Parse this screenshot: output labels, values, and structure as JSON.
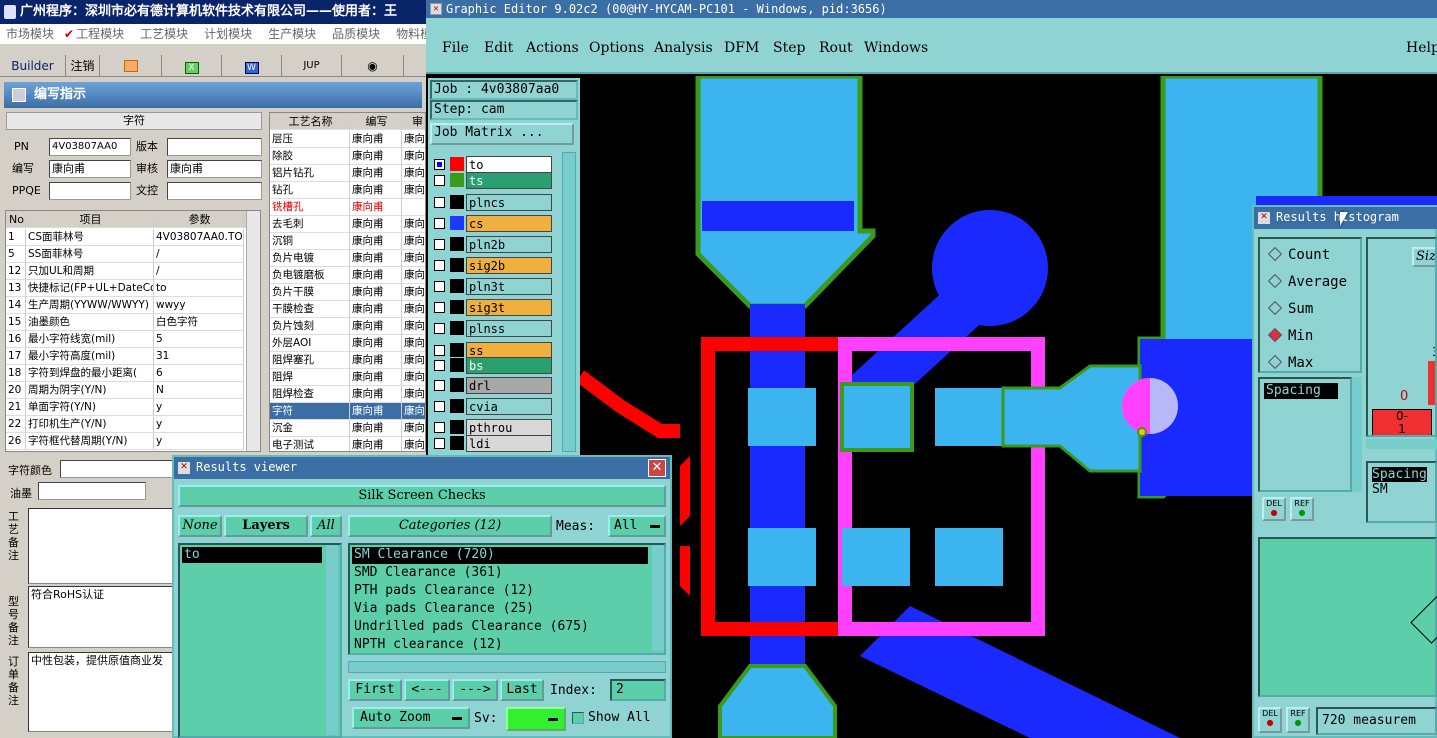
{
  "left_app": {
    "title": "广州程序：深圳市必有德计算机软件技术有限公司——使用者：王",
    "menu": [
      "市场模块",
      "工程模块",
      "工艺模块",
      "计划模块",
      "生产模块",
      "品质模块",
      "物料模"
    ],
    "toolbar": [
      "Builder",
      "注销",
      "JUP"
    ],
    "subtitle": "编写指示",
    "form_header": "字符",
    "pn_label": "PN",
    "pn_value": "4V03807AA0",
    "version_label": "版本",
    "version_value": "",
    "author_label": "编写",
    "author_value": "康向甫",
    "review_label": "审核",
    "review_value": "康向甫",
    "ppqe_label": "PPQE",
    "ppqe_value": "",
    "doc_label": "文控",
    "doc_value": "",
    "param_headers": [
      "No",
      "项目",
      "参数"
    ],
    "params": [
      [
        "1",
        "CS面菲林号",
        "4V03807AA0.TO"
      ],
      [
        "5",
        "SS面菲林号",
        "/"
      ],
      [
        "12",
        "只加UL和周期",
        "/"
      ],
      [
        "13",
        "快捷标记(FP+UL+DateCo",
        "to"
      ],
      [
        "14",
        "生产周期(YYWW/WWYY)",
        "wwyy"
      ],
      [
        "15",
        "油墨颜色",
        "白色字符"
      ],
      [
        "16",
        "最小字符线宽(mil)",
        "5"
      ],
      [
        "17",
        "最小字符高度(mil)",
        "31"
      ],
      [
        "18",
        "字符到焊盘的最小距离(",
        "6"
      ],
      [
        "20",
        "周期为阴字(Y/N)",
        "N"
      ],
      [
        "21",
        "单面字符(Y/N)",
        "y"
      ],
      [
        "22",
        "打印机生产(Y/N)",
        "y"
      ],
      [
        "26",
        "字符框代替周期(Y/N)",
        "y"
      ]
    ],
    "proc_headers": [
      "工艺名称",
      "编写",
      "审"
    ],
    "procs": [
      [
        "层压",
        "康向甫",
        "康向"
      ],
      [
        "除胶",
        "康向甫",
        "康向"
      ],
      [
        "铝片钻孔",
        "康向甫",
        "康向"
      ],
      [
        "钻孔",
        "康向甫",
        "康向"
      ],
      [
        "铣槽孔",
        "康向甫",
        ""
      ],
      [
        "去毛刺",
        "康向甫",
        "康向"
      ],
      [
        "沉铜",
        "康向甫",
        "康向"
      ],
      [
        "负片电镀",
        "康向甫",
        "康向"
      ],
      [
        "负电镀磨板",
        "康向甫",
        "康向"
      ],
      [
        "负片干膜",
        "康向甫",
        "康向"
      ],
      [
        "干膜检查",
        "康向甫",
        "康向"
      ],
      [
        "负片蚀刻",
        "康向甫",
        "康向"
      ],
      [
        "外层AOI",
        "康向甫",
        "康向"
      ],
      [
        "阻焊塞孔",
        "康向甫",
        "康向"
      ],
      [
        "阻焊",
        "康向甫",
        "康向"
      ],
      [
        "阻焊检查",
        "康向甫",
        "康向"
      ],
      [
        "字符",
        "康向甫",
        "康向"
      ],
      [
        "沉金",
        "康向甫",
        "康向"
      ],
      [
        "电子测试",
        "康向甫",
        "康向"
      ]
    ],
    "char_color_label": "字符颜色",
    "ink_label": "油墨",
    "craft_note_label": "工艺备注",
    "model_note_label": "型号备注",
    "model_note_value": "符合RoHS认证",
    "order_note_label": "订单备注",
    "order_note_value": "中性包装，提供原值商业发"
  },
  "editor": {
    "title": "Graphic Editor 9.02c2 (00@HY-HYCAM-PC101 - Windows, pid:3656)",
    "menu": [
      "File",
      "Edit",
      "Actions",
      "Options",
      "Analysis",
      "DFM",
      "Step",
      "Rout",
      "Windows"
    ],
    "help": "Help",
    "job": "Job : 4v03807aa0",
    "step": "Step: cam",
    "job_matrix": "Job Matrix ...",
    "layers": [
      {
        "name": "to",
        "color": "#ff0000",
        "bg": "#ffffff"
      },
      {
        "name": "ts",
        "color": "#3a9a1a",
        "bg": "#2aa070"
      },
      {
        "name": "plncs",
        "color": "#000000",
        "bg": "#8fd3d3"
      },
      {
        "name": "cs",
        "color": "#1a3aff",
        "bg": "#f0b040"
      },
      {
        "name": "pln2b",
        "color": "#000000",
        "bg": "#8fd3d3"
      },
      {
        "name": "sig2b",
        "color": "#000000",
        "bg": "#f0b040"
      },
      {
        "name": "pln3t",
        "color": "#000000",
        "bg": "#8fd3d3"
      },
      {
        "name": "sig3t",
        "color": "#000000",
        "bg": "#f0b040"
      },
      {
        "name": "plnss",
        "color": "#000000",
        "bg": "#8fd3d3"
      },
      {
        "name": "ss",
        "color": "#000000",
        "bg": "#f0b040"
      },
      {
        "name": "bs",
        "color": "#000000",
        "bg": "#2aa070"
      },
      {
        "name": "drl",
        "color": "#000000",
        "bg": "#a8a8a8"
      },
      {
        "name": "cvia",
        "color": "#000000",
        "bg": "#8fd3d3"
      },
      {
        "name": "pthrou",
        "color": "#000000",
        "bg": "#d8d8d8"
      },
      {
        "name": "ldi",
        "color": "#000000",
        "bg": "#d8d8d8"
      }
    ]
  },
  "results_viewer": {
    "title": "Results viewer",
    "header": "Silk Screen Checks",
    "none": "None",
    "layers": "Layers",
    "all": "All",
    "layer_items": [
      "to"
    ],
    "categories_label": "Categories (12)",
    "meas_label": "Meas:",
    "meas_value": "All",
    "categories": [
      "SM Clearance (720)",
      "SMD Clearance (361)",
      "PTH pads Clearance (12)",
      "Via pads Clearance (25)",
      "Undrilled pads Clearance (675)",
      "NPTH clearance (12)"
    ],
    "first": "First",
    "prev": "<---",
    "next": "--->",
    "last": "Last",
    "index_label": "Index:",
    "index_value": "2",
    "auto_zoom": "Auto Zoom",
    "sv_label": "Sv:",
    "show_all": "Show All"
  },
  "histogram": {
    "title": "Results histogram",
    "options": [
      "Count",
      "Average",
      "Sum",
      "Min",
      "Max"
    ],
    "selected": "Min",
    "size_label": "Siz",
    "list_item": "Spacing",
    "detail1": "Spacing",
    "detail2": "SM",
    "bar_label1": "0",
    "bar_label2": "3",
    "bar_tick": "0-",
    "bar_tick2": "1",
    "del": "DEL",
    "ref": "REF",
    "measure_text": "720 measurem"
  }
}
